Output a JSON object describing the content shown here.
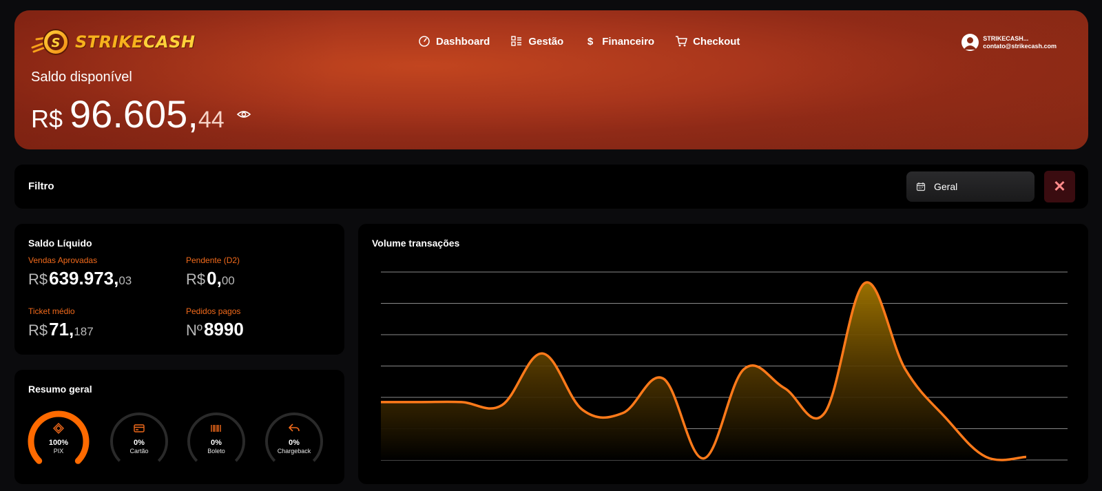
{
  "brand": {
    "name_part1": "STRIKE",
    "name_part2": "CASH"
  },
  "nav": [
    {
      "label": "Dashboard",
      "icon": "gauge-icon"
    },
    {
      "label": "Gestão",
      "icon": "list-icon"
    },
    {
      "label": "Financeiro",
      "icon": "dollar-icon"
    },
    {
      "label": "Checkout",
      "icon": "cart-icon"
    }
  ],
  "user": {
    "name": "STRIKECASH...",
    "email": "contato@strikecash.com"
  },
  "balance": {
    "label": "Saldo disponível",
    "currency": "R$",
    "whole": "96.605,",
    "cents": "44"
  },
  "filter": {
    "title": "Filtro",
    "selected": "Geral"
  },
  "saldo_liquido": {
    "title": "Saldo Líquido",
    "vendas": {
      "label": "Vendas Aprovadas",
      "prefix": "R$",
      "main": "639.973,",
      "sub": "03"
    },
    "pendente": {
      "label": "Pendente (D2)",
      "prefix": "R$",
      "main": "0,",
      "sub": "00"
    },
    "ticket": {
      "label": "Ticket médio",
      "prefix": "R$",
      "main": "71,",
      "sub": "187"
    },
    "pedidos": {
      "label": "Pedidos pagos",
      "prefix": "Nº",
      "main": "8990",
      "sub": ""
    }
  },
  "resumo": {
    "title": "Resumo geral",
    "items": [
      {
        "pct": "100%",
        "name": "PIX",
        "value": 1.0,
        "icon": "pix-icon"
      },
      {
        "pct": "0%",
        "name": "Cartão",
        "value": 0.0,
        "icon": "card-icon"
      },
      {
        "pct": "0%",
        "name": "Boleto",
        "value": 0.0,
        "icon": "barcode-icon"
      },
      {
        "pct": "0%",
        "name": "Chargeback",
        "value": 0.0,
        "icon": "undo-icon"
      }
    ]
  },
  "colors": {
    "accent": "#f26a1b",
    "line": "#ff7a1a"
  },
  "chart_data": {
    "title": "Volume transações",
    "type": "area",
    "xlabel": "",
    "ylabel": "",
    "grid": true,
    "ylim": [
      0,
      6
    ],
    "values": [
      1.85,
      1.85,
      1.85,
      1.75,
      3.4,
      1.6,
      1.5,
      2.6,
      0.05,
      2.9,
      2.3,
      1.5,
      5.65,
      2.9,
      1.35,
      0.1,
      0.1
    ]
  }
}
